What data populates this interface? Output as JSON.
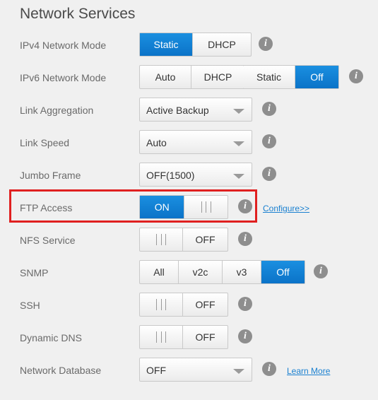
{
  "title": "Network Services",
  "colors": {
    "accent": "#0b7fd4",
    "highlight": "#e02020",
    "link": "#1a80d0"
  },
  "icons": {
    "info": "info-icon",
    "dropdown": "chevron-down-icon",
    "grip": "toggle-grip-icon"
  },
  "info_glyph": "i",
  "rows": {
    "ipv4": {
      "label": "IPv4 Network Mode",
      "options": [
        "Static",
        "DHCP"
      ],
      "selected": "Static"
    },
    "ipv6": {
      "label": "IPv6 Network Mode",
      "options": [
        "Auto",
        "DHCP",
        "Static",
        "Off"
      ],
      "selected": "Off"
    },
    "link_aggregation": {
      "label": "Link Aggregation",
      "value": "Active Backup"
    },
    "link_speed": {
      "label": "Link Speed",
      "value": "Auto"
    },
    "jumbo_frame": {
      "label": "Jumbo Frame",
      "value": "OFF(1500)"
    },
    "ftp": {
      "label": "FTP Access",
      "state": "ON",
      "link": "Configure>>"
    },
    "nfs": {
      "label": "NFS Service",
      "state": "OFF"
    },
    "snmp": {
      "label": "SNMP",
      "options": [
        "All",
        "v2c",
        "v3",
        "Off"
      ],
      "selected": "Off"
    },
    "ssh": {
      "label": "SSH",
      "state": "OFF"
    },
    "ddns": {
      "label": "Dynamic DNS",
      "state": "OFF"
    },
    "network_database": {
      "label": "Network Database",
      "value": "OFF",
      "link": "Learn More"
    }
  }
}
